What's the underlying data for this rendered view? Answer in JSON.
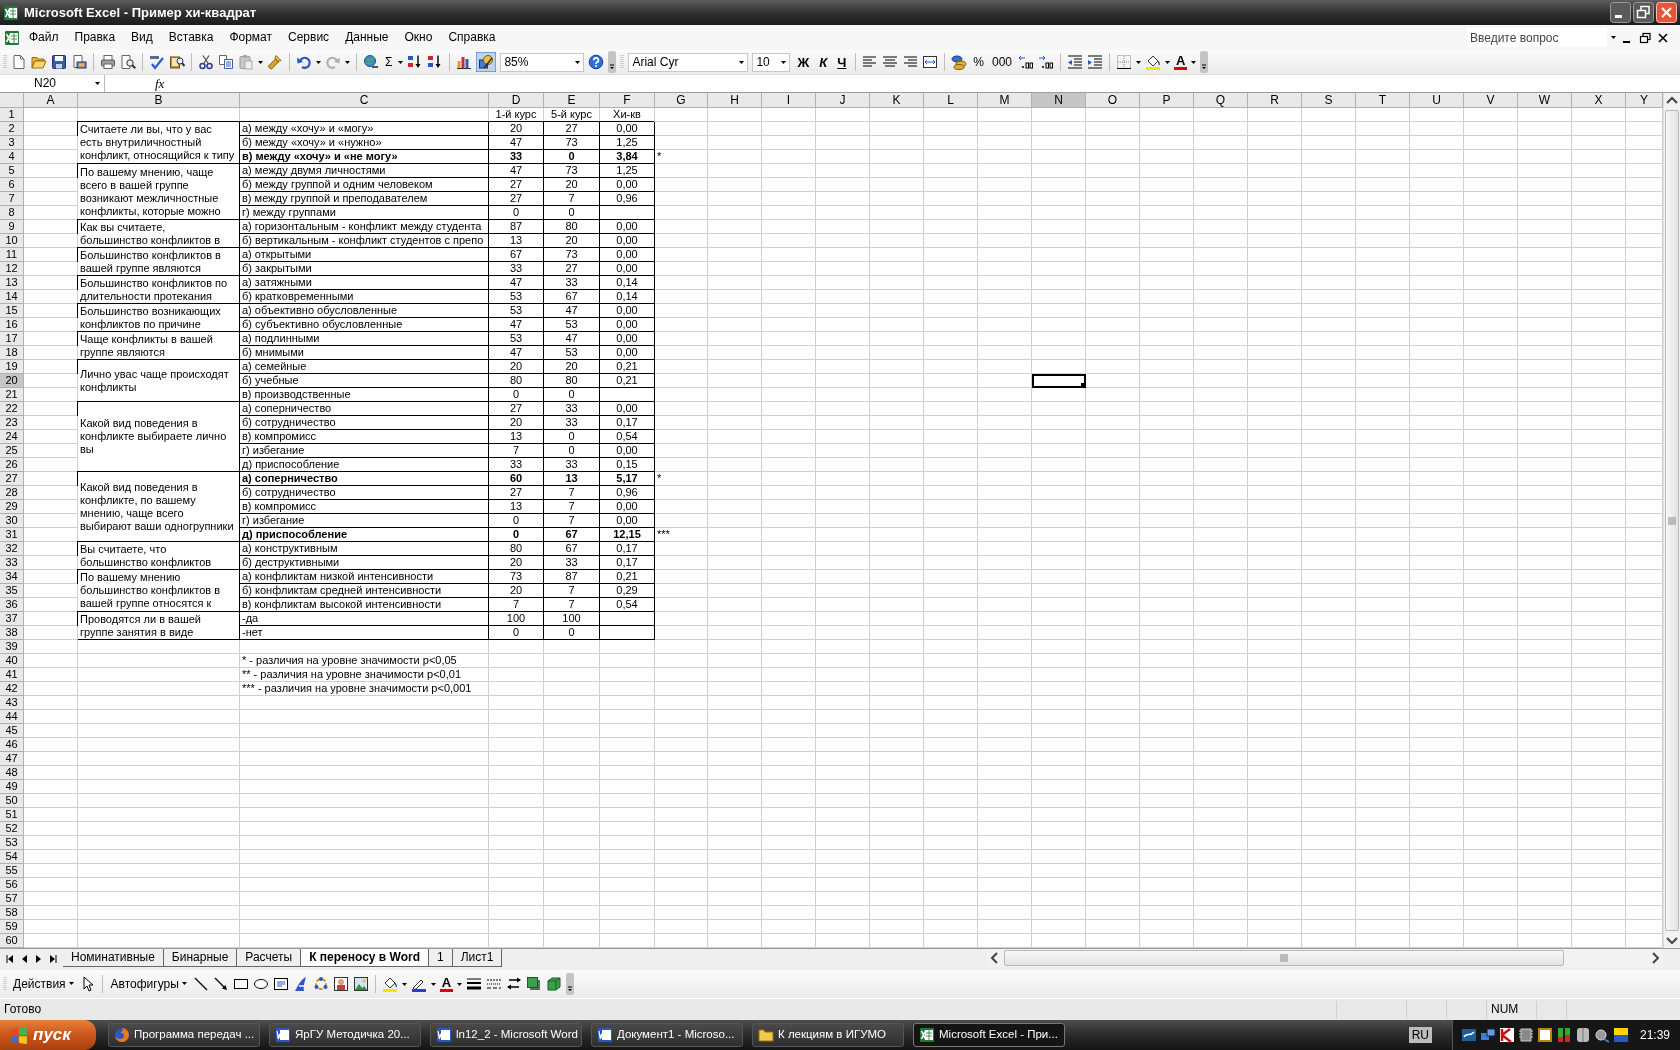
{
  "window": {
    "title": "Microsoft Excel - Пример хи-квадрат"
  },
  "menu": [
    "Файл",
    "Правка",
    "Вид",
    "Вставка",
    "Формат",
    "Сервис",
    "Данные",
    "Окно",
    "Справка"
  ],
  "help_box": {
    "placeholder": "Введите вопрос"
  },
  "toolbar": {
    "sum": "Σ",
    "drawing_button": {
      "on": true
    },
    "zoom": "85%",
    "font": "Arial Cyr",
    "font_size": "10",
    "bold_key": "Ж",
    "italic_key": "К",
    "underline_key": "Ч",
    "percent_key": "%",
    "thousands_key": "000",
    "font_color_key": "A"
  },
  "formula_bar": {
    "name_box": "N20",
    "function_key": "fx"
  },
  "sheet": {
    "columns": [
      {
        "letter": "A",
        "selected": false
      },
      {
        "letter": "B",
        "selected": false
      },
      {
        "letter": "C",
        "selected": false
      },
      {
        "letter": "D",
        "selected": false
      },
      {
        "letter": "E",
        "selected": false
      },
      {
        "letter": "F",
        "selected": false
      },
      {
        "letter": "G",
        "selected": false
      },
      {
        "letter": "H",
        "selected": false
      },
      {
        "letter": "I",
        "selected": false
      },
      {
        "letter": "J",
        "selected": false
      },
      {
        "letter": "K",
        "selected": false
      },
      {
        "letter": "L",
        "selected": false
      },
      {
        "letter": "M",
        "selected": false
      },
      {
        "letter": "N",
        "selected": true
      },
      {
        "letter": "O",
        "selected": false
      },
      {
        "letter": "P",
        "selected": false
      },
      {
        "letter": "Q",
        "selected": false
      },
      {
        "letter": "R",
        "selected": false
      },
      {
        "letter": "S",
        "selected": false
      },
      {
        "letter": "T",
        "selected": false
      },
      {
        "letter": "U",
        "selected": false
      },
      {
        "letter": "V",
        "selected": false
      },
      {
        "letter": "W",
        "selected": false
      },
      {
        "letter": "X",
        "selected": false
      },
      {
        "letter": "Y",
        "selected": false
      }
    ],
    "rows": [
      {
        "number": "1",
        "selected": false
      },
      {
        "number": "2",
        "selected": false
      },
      {
        "number": "3",
        "selected": false
      },
      {
        "number": "4",
        "selected": false
      },
      {
        "number": "5",
        "selected": false
      },
      {
        "number": "6",
        "selected": false
      },
      {
        "number": "7",
        "selected": false
      },
      {
        "number": "8",
        "selected": false
      },
      {
        "number": "9",
        "selected": false
      },
      {
        "number": "10",
        "selected": false
      },
      {
        "number": "11",
        "selected": false
      },
      {
        "number": "12",
        "selected": false
      },
      {
        "number": "13",
        "selected": false
      },
      {
        "number": "14",
        "selected": false
      },
      {
        "number": "15",
        "selected": false
      },
      {
        "number": "16",
        "selected": false
      },
      {
        "number": "17",
        "selected": false
      },
      {
        "number": "18",
        "selected": false
      },
      {
        "number": "19",
        "selected": false
      },
      {
        "number": "20",
        "selected": true
      },
      {
        "number": "21",
        "selected": false
      },
      {
        "number": "22",
        "selected": false
      },
      {
        "number": "23",
        "selected": false
      },
      {
        "number": "24",
        "selected": false
      },
      {
        "number": "25",
        "selected": false
      },
      {
        "number": "26",
        "selected": false
      },
      {
        "number": "27",
        "selected": false
      },
      {
        "number": "28",
        "selected": false
      },
      {
        "number": "29",
        "selected": false
      },
      {
        "number": "30",
        "selected": false
      },
      {
        "number": "31",
        "selected": false
      },
      {
        "number": "32",
        "selected": false
      },
      {
        "number": "33",
        "selected": false
      },
      {
        "number": "34",
        "selected": false
      },
      {
        "number": "35",
        "selected": false
      },
      {
        "number": "36",
        "selected": false
      },
      {
        "number": "37",
        "selected": false
      },
      {
        "number": "38",
        "selected": false
      },
      {
        "number": "39",
        "selected": false
      },
      {
        "number": "40",
        "selected": false
      },
      {
        "number": "41",
        "selected": false
      },
      {
        "number": "42",
        "selected": false
      },
      {
        "number": "43",
        "selected": false
      },
      {
        "number": "44",
        "selected": false
      },
      {
        "number": "45",
        "selected": false
      },
      {
        "number": "46",
        "selected": false
      },
      {
        "number": "47",
        "selected": false
      },
      {
        "number": "48",
        "selected": false
      },
      {
        "number": "49",
        "selected": false
      },
      {
        "number": "50",
        "selected": false
      },
      {
        "number": "51",
        "selected": false
      },
      {
        "number": "52",
        "selected": false
      },
      {
        "number": "53",
        "selected": false
      },
      {
        "number": "54",
        "selected": false
      },
      {
        "number": "55",
        "selected": false
      },
      {
        "number": "56",
        "selected": false
      },
      {
        "number": "57",
        "selected": false
      },
      {
        "number": "58",
        "selected": false
      },
      {
        "number": "59",
        "selected": false
      },
      {
        "number": "60",
        "selected": false
      }
    ],
    "header": {
      "course_1": "1-й курс",
      "course_5": "5-й курс",
      "chi_sq": "Хи-кв"
    },
    "groups": [
      {
        "question_lines": [
          "Считаете ли вы, что у вас",
          "есть внутриличностный",
          "конфликт, относящийся к типу"
        ],
        "answers": [
          {
            "option": "а) между «хочу» и «могу»",
            "course_1": "20",
            "course_5": "27",
            "chi_sq": "0,00",
            "bold": false
          },
          {
            "option": "б) между «хочу» и «нужно»",
            "course_1": "47",
            "course_5": "73",
            "chi_sq": "1,25",
            "bold": false
          },
          {
            "option": "в) между «хочу» и «не могу»",
            "course_1": "33",
            "course_5": "0",
            "chi_sq": "3,84",
            "significance": "*",
            "bold": true
          }
        ]
      },
      {
        "question_lines": [
          "По вашему мнению, чаще",
          "всего в вашей группе",
          "возникают межличностные",
          "конфликты, которые можно"
        ],
        "answers": [
          {
            "option": "а) между двумя личностями",
            "course_1": "47",
            "course_5": "73",
            "chi_sq": "1,25",
            "bold": false
          },
          {
            "option": "б) между группой и одним человеком",
            "course_1": "27",
            "course_5": "20",
            "chi_sq": "0,00",
            "bold": false
          },
          {
            "option": "в) между группой и преподавателем",
            "course_1": "27",
            "course_5": "7",
            "chi_sq": "0,96",
            "bold": false
          },
          {
            "option": "г) между группами",
            "course_1": "0",
            "course_5": "0",
            "bold": false
          }
        ]
      },
      {
        "question_lines": [
          "Как вы считаете,",
          "большинство конфликтов в"
        ],
        "answers": [
          {
            "option": "а) горизонтальным - конфликт между студента",
            "course_1": "87",
            "course_5": "80",
            "chi_sq": "0,00",
            "bold": false
          },
          {
            "option": "б) вертикальным - конфликт студентов с препо",
            "course_1": "13",
            "course_5": "20",
            "chi_sq": "0,00",
            "bold": false
          }
        ]
      },
      {
        "question_lines": [
          "Большинство конфликтов в",
          "вашей группе являются"
        ],
        "answers": [
          {
            "option": "а) открытыми",
            "course_1": "67",
            "course_5": "73",
            "chi_sq": "0,00",
            "bold": false
          },
          {
            "option": "б) закрытыми",
            "course_1": "33",
            "course_5": "27",
            "chi_sq": "0,00",
            "bold": false
          }
        ]
      },
      {
        "question_lines": [
          "Большинство конфликтов по",
          "длительности протекания"
        ],
        "answers": [
          {
            "option": "а) затяжными",
            "course_1": "47",
            "course_5": "33",
            "chi_sq": "0,14",
            "bold": false
          },
          {
            "option": "б) кратковременными",
            "course_1": "53",
            "course_5": "67",
            "chi_sq": "0,14",
            "bold": false
          }
        ]
      },
      {
        "question_lines": [
          "Большинство возникающих",
          "конфликтов по причине"
        ],
        "answers": [
          {
            "option": "а) объективно обусловленные",
            "course_1": "53",
            "course_5": "47",
            "chi_sq": "0,00",
            "bold": false
          },
          {
            "option": "б) субъективно обусловленные",
            "course_1": "47",
            "course_5": "53",
            "chi_sq": "0,00",
            "bold": false
          }
        ]
      },
      {
        "question_lines": [
          "Чаще конфликты в вашей",
          "группе являются"
        ],
        "answers": [
          {
            "option": "а) подлинными",
            "course_1": "53",
            "course_5": "47",
            "chi_sq": "0,00",
            "bold": false
          },
          {
            "option": "б) мнимыми",
            "course_1": "47",
            "course_5": "53",
            "chi_sq": "0,00",
            "bold": false
          }
        ]
      },
      {
        "question_lines": [
          "Лично увас чаще происходят",
          "конфликты"
        ],
        "answers": [
          {
            "option": "а) семейные",
            "course_1": "20",
            "course_5": "20",
            "chi_sq": "0,21",
            "bold": false
          },
          {
            "option": "б) учебные",
            "course_1": "80",
            "course_5": "80",
            "chi_sq": "0,21",
            "bold": false
          },
          {
            "option": "в) производственные",
            "course_1": "0",
            "course_5": "0",
            "bold": false
          }
        ]
      },
      {
        "question_lines": [
          "Какой вид поведения в",
          "конфликте выбираете лично",
          "вы"
        ],
        "answers": [
          {
            "option": "а) соперничество",
            "course_1": "27",
            "course_5": "33",
            "chi_sq": "0,00",
            "bold": false
          },
          {
            "option": "б) сотрудничество",
            "course_1": "20",
            "course_5": "33",
            "chi_sq": "0,17",
            "bold": false
          },
          {
            "option": "в) компромисс",
            "course_1": "13",
            "course_5": "0",
            "chi_sq": "0,54",
            "bold": false
          },
          {
            "option": "г) избегание",
            "course_1": "7",
            "course_5": "0",
            "chi_sq": "0,00",
            "bold": false
          },
          {
            "option": "д) приспособление",
            "course_1": "33",
            "course_5": "33",
            "chi_sq": "0,15",
            "bold": false
          }
        ]
      },
      {
        "question_lines": [
          "Какой вид поведения в",
          "конфликте, по вашему",
          "мнению, чаще всего",
          "выбирают ваши одногрупники"
        ],
        "answers": [
          {
            "option": "а) соперничество",
            "course_1": "60",
            "course_5": "13",
            "chi_sq": "5,17",
            "significance": "*",
            "bold": true
          },
          {
            "option": "б) сотрудничество",
            "course_1": "27",
            "course_5": "7",
            "chi_sq": "0,96",
            "bold": false
          },
          {
            "option": "в) компромисс",
            "course_1": "13",
            "course_5": "7",
            "chi_sq": "0,00",
            "bold": false
          },
          {
            "option": "г) избегание",
            "course_1": "0",
            "course_5": "7",
            "chi_sq": "0,00",
            "bold": false
          },
          {
            "option": "д) приспособление",
            "course_1": "0",
            "course_5": "67",
            "chi_sq": "12,15",
            "significance": "***",
            "bold": true
          }
        ]
      },
      {
        "question_lines": [
          "Вы считаете, что",
          "большинство конфликтов"
        ],
        "answers": [
          {
            "option": "а) конструктивным",
            "course_1": "80",
            "course_5": "67",
            "chi_sq": "0,17",
            "bold": false
          },
          {
            "option": "б) деструктивными",
            "course_1": "20",
            "course_5": "33",
            "chi_sq": "0,17",
            "bold": false
          }
        ]
      },
      {
        "question_lines": [
          "По вашему мнению",
          "большинство конфликтов в",
          "вашей группе относятся к"
        ],
        "answers": [
          {
            "option": "а) конфликтам низкой интенсивности",
            "course_1": "73",
            "course_5": "87",
            "chi_sq": "0,21",
            "bold": false
          },
          {
            "option": "б) конфликтам средней интенсивности",
            "course_1": "20",
            "course_5": "7",
            "chi_sq": "0,29",
            "bold": false
          },
          {
            "option": "в) конфликтам высокой интенсивности",
            "course_1": "7",
            "course_5": "7",
            "chi_sq": "0,54",
            "bold": false
          }
        ]
      },
      {
        "question_lines": [
          "Проводятся ли в вашей",
          "группе занятия в виде"
        ],
        "answers": [
          {
            "option": "-да",
            "course_1": "100",
            "course_5": "100",
            "bold": false
          },
          {
            "option": "-нет",
            "course_1": "0",
            "course_5": "0",
            "bold": false
          }
        ]
      }
    ],
    "notes": [
      "* - различия на уровне значимости р<0,05",
      "** - различия на уровне значимости р<0,01",
      "*** - различия на уровне значимости р<0,001"
    ]
  },
  "sheet_tabs": [
    {
      "label": "Номинативные",
      "selected": false
    },
    {
      "label": "Бинарные",
      "selected": false
    },
    {
      "label": "Расчеты",
      "selected": false
    },
    {
      "label": "К переносу в Word",
      "selected": true
    },
    {
      "label": "1",
      "selected": false
    },
    {
      "label": "Лист1",
      "selected": false
    }
  ],
  "drawing_toolbar": {
    "actions": "Действия",
    "autoshapes": "Автофигуры",
    "font_color_key": "A"
  },
  "status_bar": {
    "status": "Готово",
    "indicator": "NUM"
  },
  "taskbar": {
    "start": "пуск",
    "tasks": [
      {
        "label": "Программа передач ...",
        "selected": false
      },
      {
        "label": "ЯрГУ Методичка 20...",
        "selected": false
      },
      {
        "label": "ln12_2 - Microsoft Word",
        "selected": false
      },
      {
        "label": "Документ1 - Microso...",
        "selected": false
      },
      {
        "label": "К лекциям в ИГУМО",
        "selected": false
      },
      {
        "label": "Microsoft Excel - При...",
        "selected": true
      }
    ],
    "language": "RU",
    "clock": "21:39"
  }
}
